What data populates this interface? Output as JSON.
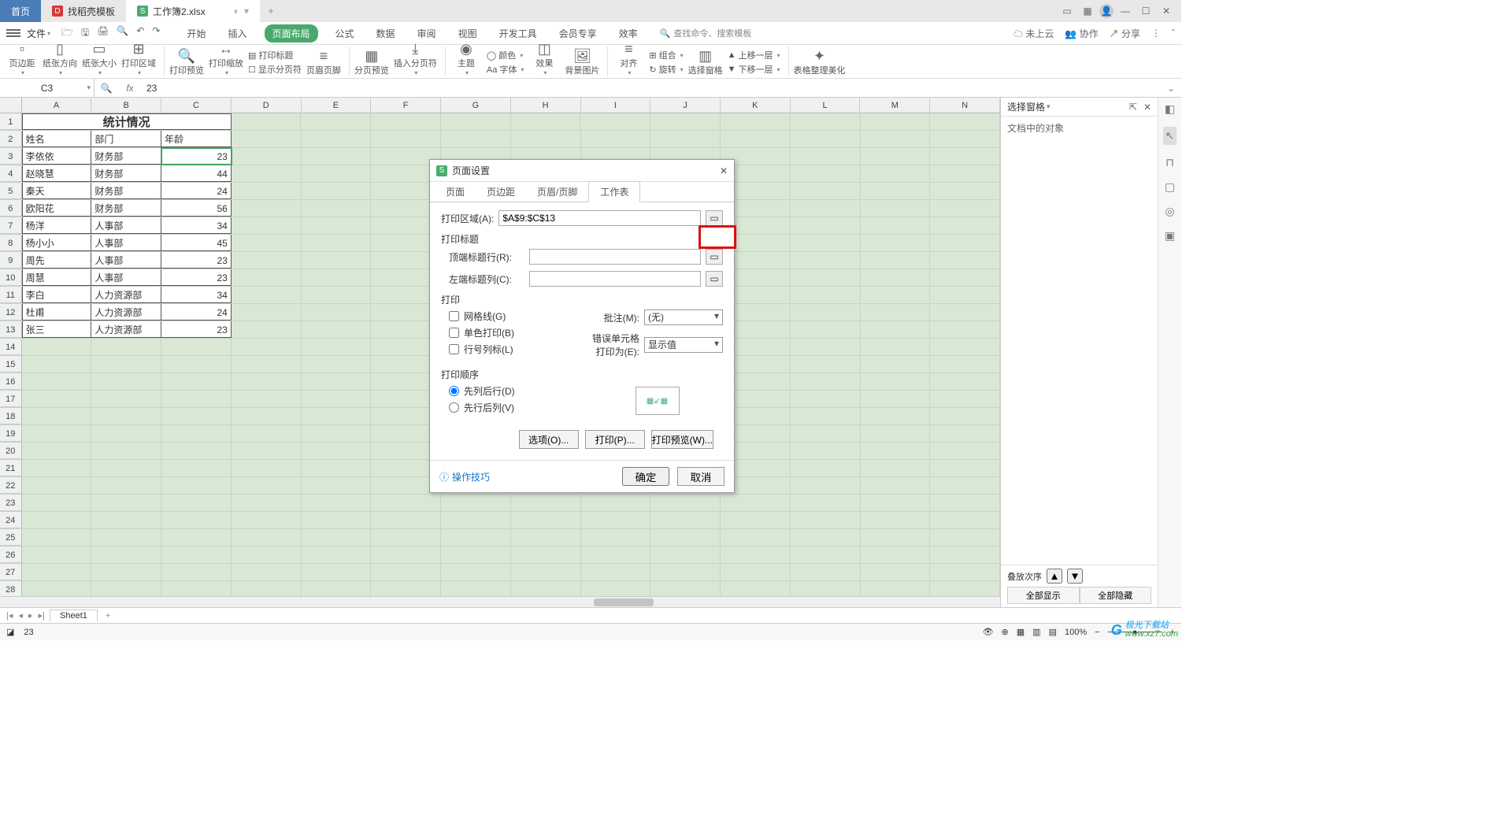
{
  "tabs": {
    "home": "首页",
    "doc1": "找稻壳模板",
    "doc2": "工作簿2.xlsx",
    "close_tooltip": "+"
  },
  "window": {
    "cloud": "未上云",
    "collab": "协作",
    "share": "分享"
  },
  "menu": {
    "file": "文件",
    "items": [
      "开始",
      "插入",
      "页面布局",
      "公式",
      "数据",
      "审阅",
      "视图",
      "开发工具",
      "会员专享",
      "效率"
    ],
    "active_index": 2,
    "search_hint": "查找命令、搜索模板"
  },
  "ribbon": {
    "margins": "页边距",
    "orientation": "纸张方向",
    "size": "纸张大小",
    "print_area": "打印区域",
    "preview": "打印预览",
    "scale": "打印缩放",
    "titles": "打印标题",
    "show_breaks": "显示分页符",
    "hf": "页眉页脚",
    "breaks": "分页预览",
    "insert_break": "插入分页符",
    "theme": "主题",
    "color": "颜色",
    "font": "Aa 字体",
    "effect": "效果",
    "bg": "背景图片",
    "align": "对齐",
    "group": "组合",
    "rotate": "旋转",
    "select_pane": "选择窗格",
    "bring_fwd": "上移一层",
    "send_back": "下移一层",
    "beautify": "表格整理美化"
  },
  "formula": {
    "namebox": "C3",
    "value": "23"
  },
  "cols": [
    "A",
    "B",
    "C",
    "D",
    "E",
    "F",
    "G",
    "H",
    "I",
    "J",
    "K",
    "L",
    "M",
    "N"
  ],
  "rows_count": 28,
  "table": {
    "title": "统计情况",
    "headers": [
      "姓名",
      "部门",
      "年龄"
    ],
    "rows": [
      [
        "李依依",
        "财务部",
        "23"
      ],
      [
        "赵晓慧",
        "财务部",
        "44"
      ],
      [
        "秦天",
        "财务部",
        "24"
      ],
      [
        "欧阳花",
        "财务部",
        "56"
      ],
      [
        "杨洋",
        "人事部",
        "34"
      ],
      [
        "杨小小",
        "人事部",
        "45"
      ],
      [
        "周先",
        "人事部",
        "23"
      ],
      [
        "周慧",
        "人事部",
        "23"
      ],
      [
        "李白",
        "人力资源部",
        "34"
      ],
      [
        "杜甫",
        "人力资源部",
        "24"
      ],
      [
        "张三",
        "人力资源部",
        "23"
      ]
    ]
  },
  "sidepanel": {
    "title": "选择窗格",
    "empty": "文档中的对象",
    "stack": "叠放次序",
    "show_all": "全部显示",
    "hide_all": "全部隐藏"
  },
  "sheettab": "Sheet1",
  "status": {
    "hint": "23",
    "zoom": "100%"
  },
  "dialog": {
    "title": "页面设置",
    "tabs": [
      "页面",
      "页边距",
      "页眉/页脚",
      "工作表"
    ],
    "active_tab": 3,
    "print_area_label": "打印区域(A):",
    "print_area_value": "$A$9:$C$13",
    "titles_section": "打印标题",
    "top_rows_label": "顶端标题行(R):",
    "left_cols_label": "左端标题列(C):",
    "print_section": "打印",
    "cb_grid": "网格线(G)",
    "cb_bw": "单色打印(B)",
    "cb_rowcol": "行号列标(L)",
    "comments_label": "批注(M):",
    "comments_value": "(无)",
    "errors_label": "错误单元格打印为(E):",
    "errors_value": "显示值",
    "order_section": "打印顺序",
    "order_down": "先列后行(D)",
    "order_across": "先行后列(V)",
    "options_btn": "选项(O)...",
    "print_btn": "打印(P)...",
    "preview_btn": "打印预览(W)...",
    "ok": "确定",
    "cancel": "取消",
    "tip": "操作技巧"
  },
  "watermark": {
    "site": "极光下载站",
    "url": "www.xz7.com"
  }
}
